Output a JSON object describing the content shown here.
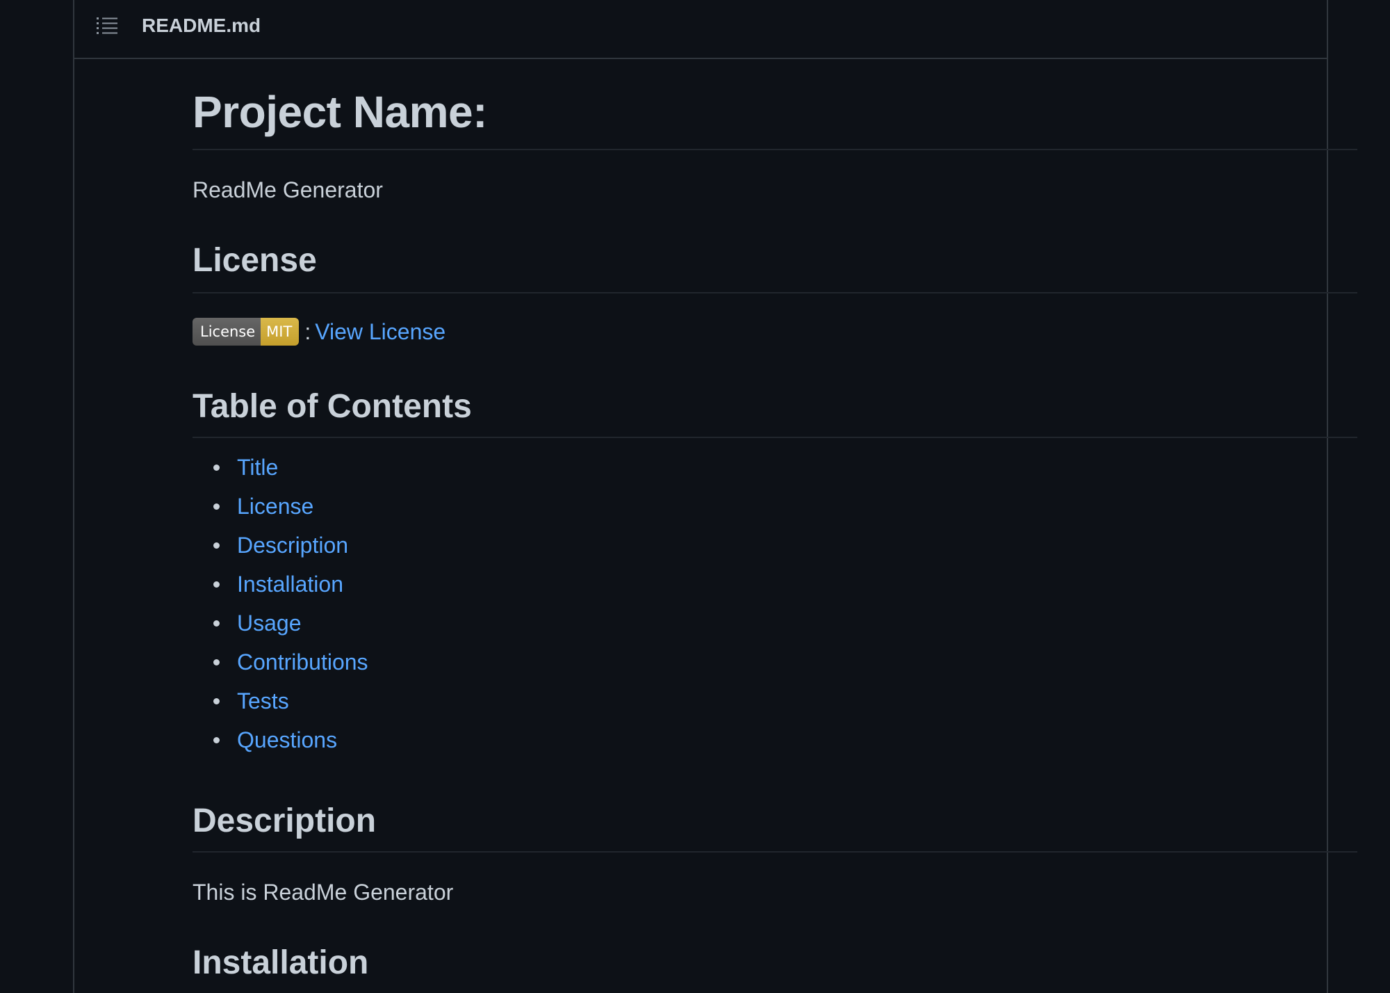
{
  "file_header": {
    "file_name": "README.md",
    "toc_icon": "list-icon"
  },
  "readme": {
    "title": "Project Name:",
    "project_name": "ReadMe Generator",
    "license_section": {
      "heading": "License",
      "badge": {
        "left_label": "License",
        "right_label": "MIT",
        "left_color": "#555555",
        "right_color": "#dfb317"
      },
      "separator": ":",
      "link_label": "View License"
    },
    "toc_section": {
      "heading": "Table of Contents",
      "items": [
        {
          "label": "Title"
        },
        {
          "label": "License"
        },
        {
          "label": "Description"
        },
        {
          "label": "Installation"
        },
        {
          "label": "Usage"
        },
        {
          "label": "Contributions"
        },
        {
          "label": "Tests"
        },
        {
          "label": "Questions"
        }
      ]
    },
    "description_section": {
      "heading": "Description",
      "text": "This is ReadMe Generator"
    },
    "installation_section": {
      "heading": "Installation"
    }
  },
  "colors": {
    "background": "#0d1117",
    "border": "#30363d",
    "text": "#c9d1d9",
    "link": "#58a6ff"
  }
}
